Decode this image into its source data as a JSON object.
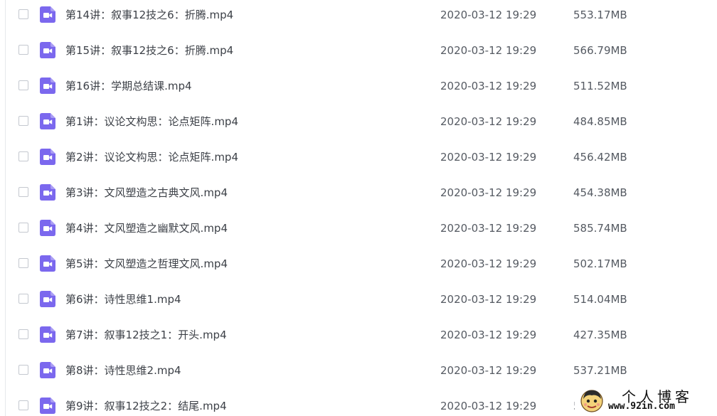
{
  "files": [
    {
      "name": "第14讲：叙事12技之6：折腾.mp4",
      "date": "2020-03-12 19:29",
      "size": "553.17MB"
    },
    {
      "name": "第15讲：叙事12技之6：折腾.mp4",
      "date": "2020-03-12 19:29",
      "size": "566.79MB"
    },
    {
      "name": "第16讲：学期总结课.mp4",
      "date": "2020-03-12 19:29",
      "size": "511.52MB"
    },
    {
      "name": "第1讲：议论文构思：论点矩阵.mp4",
      "date": "2020-03-12 19:29",
      "size": "484.85MB"
    },
    {
      "name": "第2讲：议论文构思：论点矩阵.mp4",
      "date": "2020-03-12 19:29",
      "size": "456.42MB"
    },
    {
      "name": "第3讲：文风塑造之古典文风.mp4",
      "date": "2020-03-12 19:29",
      "size": "454.38MB"
    },
    {
      "name": "第4讲：文风塑造之幽默文风.mp4",
      "date": "2020-03-12 19:29",
      "size": "585.74MB"
    },
    {
      "name": "第5讲：文风塑造之哲理文风.mp4",
      "date": "2020-03-12 19:29",
      "size": "502.17MB"
    },
    {
      "name": "第6讲：诗性思维1.mp4",
      "date": "2020-03-12 19:29",
      "size": "514.04MB"
    },
    {
      "name": "第7讲：叙事12技之1：开头.mp4",
      "date": "2020-03-12 19:29",
      "size": "427.35MB"
    },
    {
      "name": "第8讲：诗性思维2.mp4",
      "date": "2020-03-12 19:29",
      "size": "537.21MB"
    },
    {
      "name": "第9讲：叙事12技之2：结尾.mp4",
      "date": "2020-03-12 19:29",
      "size": "542.96MB"
    }
  ],
  "icons": {
    "file_type": "video-file-icon",
    "file_icon_color": "#7b68ee"
  },
  "watermark": {
    "title": "个人博客",
    "url": "www.92in.com"
  }
}
